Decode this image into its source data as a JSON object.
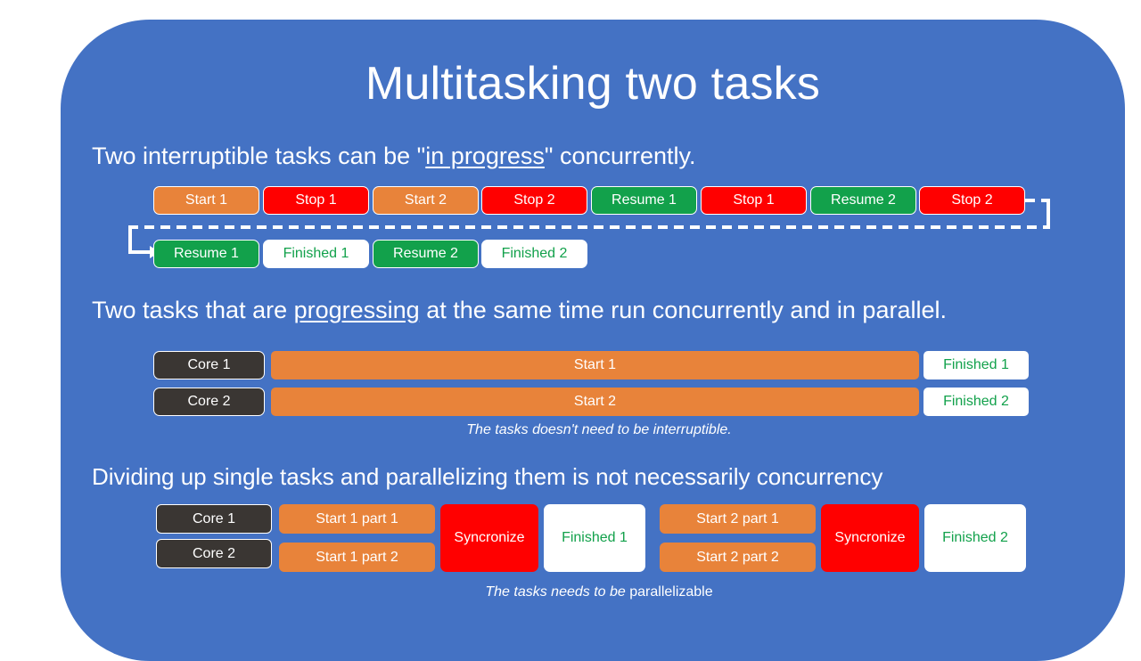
{
  "slide": {
    "title": "Multitasking two tasks",
    "background_color": "#4472C4"
  },
  "colors": {
    "background": "#4472C4",
    "start": "#E8833A",
    "stop": "#FF0000",
    "resume": "#12A14B",
    "finished_text": "#12A14B",
    "core": "#3A3633",
    "white": "#FFFFFF"
  },
  "section1": {
    "heading_before": "Two interruptible tasks can be \"",
    "heading_underlined": "in progress",
    "heading_after": "\" concurrently.",
    "row1": [
      {
        "label": "Start 1",
        "kind": "start"
      },
      {
        "label": "Stop 1",
        "kind": "stop"
      },
      {
        "label": "Start 2",
        "kind": "start"
      },
      {
        "label": "Stop 2",
        "kind": "stop"
      },
      {
        "label": "Resume 1",
        "kind": "resume"
      },
      {
        "label": "Stop 1",
        "kind": "stop"
      },
      {
        "label": "Resume 2",
        "kind": "resume"
      },
      {
        "label": "Stop 2",
        "kind": "stop"
      }
    ],
    "row2": [
      {
        "label": "Resume 1",
        "kind": "resume"
      },
      {
        "label": "Finished 1",
        "kind": "finish"
      },
      {
        "label": "Resume 2",
        "kind": "resume"
      },
      {
        "label": "Finished 2",
        "kind": "finish"
      }
    ]
  },
  "section2": {
    "heading_before": "Two tasks that are ",
    "heading_underlined": "progressing",
    "heading_after": " at the same time run concurrently and in parallel.",
    "rows": [
      {
        "core": "Core 1",
        "task": "Start 1",
        "finished": "Finished 1"
      },
      {
        "core": "Core 2",
        "task": "Start 2",
        "finished": "Finished 2"
      }
    ],
    "caption": "The tasks doesn't need to be interruptible."
  },
  "section3": {
    "heading": "Dividing up single tasks and parallelizing them is not necessarily concurrency",
    "cores": [
      "Core 1",
      "Core 2"
    ],
    "group1": {
      "parts": [
        "Start 1 part 1",
        "Start 1 part 2"
      ],
      "sync": "Syncronize",
      "finished": "Finished 1"
    },
    "group2": {
      "parts": [
        "Start 2 part 1",
        "Start 2 part 2"
      ],
      "sync": "Syncronize",
      "finished": "Finished 2"
    },
    "caption_italic": "The tasks needs to be ",
    "caption_plain": "parallelizable"
  }
}
